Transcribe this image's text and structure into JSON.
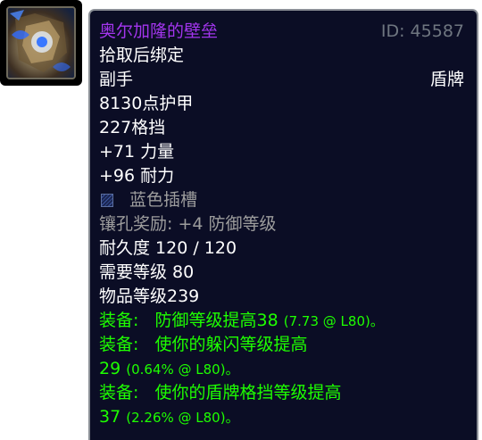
{
  "item": {
    "name": "奥尔加隆的壁垒",
    "id_label": "ID: 45587",
    "binding": "拾取后绑定",
    "slot": "副手",
    "type": "盾牌",
    "armor": "8130点护甲",
    "block": "227格挡",
    "strength": "+71 力量",
    "stamina": "+96 耐力",
    "socket": "蓝色插槽",
    "socket_bonus": "镶孔奖励: +4 防御等级",
    "durability": "耐久度 120 / 120",
    "required_level": "需要等级 80",
    "item_level": "物品等级239",
    "equip_effects": [
      {
        "prefix": "装备:",
        "text": "防御等级提高38",
        "note": "(7.73 @ L80)。",
        "continuation": "",
        "continuation_note": ""
      },
      {
        "prefix": "装备:",
        "text": "使你的躲闪等级提高",
        "note": "",
        "continuation": "29",
        "continuation_note": "(0.64% @ L80)。"
      },
      {
        "prefix": "装备:",
        "text": "使你的盾牌格挡等级提高",
        "note": "",
        "continuation": "37",
        "continuation_note": "(2.26% @ L80)。"
      }
    ]
  },
  "colors": {
    "epic": "#a335ee",
    "equip": "#1eff00",
    "grey": "#9d9d9d",
    "background": "#0b0d25"
  },
  "icon": "shield-item-icon"
}
